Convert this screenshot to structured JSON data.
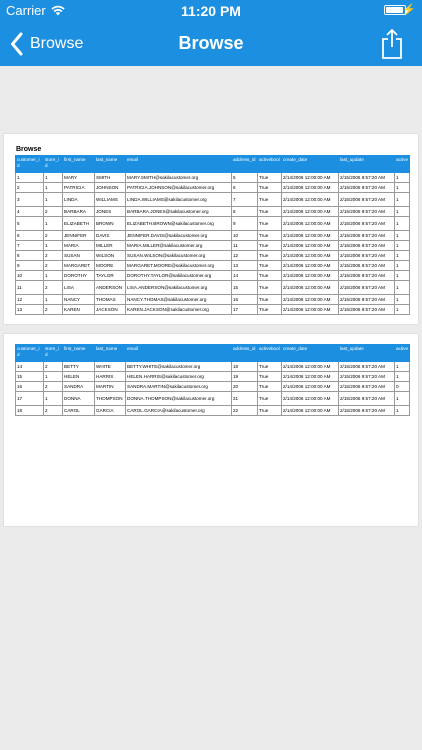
{
  "status": {
    "carrier": "Carrier",
    "time": "11:20 PM",
    "battery_fill": 0.95
  },
  "nav": {
    "back_label": "Browse",
    "title": "Browse"
  },
  "report": {
    "title": "Browse",
    "columns": [
      "customer_id",
      "store_id",
      "first_name",
      "last_name",
      "email",
      "address_id",
      "activebool",
      "create_date",
      "last_update",
      "active"
    ],
    "page1_rows": [
      [
        "1",
        "1",
        "MARY",
        "SMITH",
        "MARY.SMITH@sakilacustomer.org",
        "5",
        "True",
        "2/14/2006 12:00:00 AM",
        "2/15/2006 9:57:20 AM",
        "1"
      ],
      [
        "2",
        "1",
        "PATRICIA",
        "JOHNSON",
        "PATRICIA.JOHNSON@sakilacustomer.org",
        "6",
        "True",
        "2/14/2006 12:00:00 AM",
        "2/15/2006 9:57:20 AM",
        "1"
      ],
      [
        "3",
        "1",
        "LINDA",
        "WILLIAMS",
        "LINDA.WILLIAMS@sakilacustomer.org",
        "7",
        "True",
        "2/14/2006 12:00:00 AM",
        "2/15/2006 9:57:20 AM",
        "1"
      ],
      [
        "4",
        "2",
        "BARBARA",
        "JONES",
        "BARBARA.JONES@sakilacustomer.org",
        "8",
        "True",
        "2/14/2006 12:00:00 AM",
        "2/15/2006 9:57:20 AM",
        "1"
      ],
      [
        "5",
        "1",
        "ELIZABETH",
        "BROWN",
        "ELIZABETH.BROWN@sakilacustomer.org",
        "9",
        "True",
        "2/14/2006 12:00:00 AM",
        "2/15/2006 9:57:20 AM",
        "1"
      ],
      [
        "6",
        "2",
        "JENNIFER",
        "DAVIS",
        "JENNIFER.DAVIS@sakilacustomer.org",
        "10",
        "True",
        "2/14/2006 12:00:00 AM",
        "2/15/2006 9:57:20 AM",
        "1"
      ],
      [
        "7",
        "1",
        "MARIA",
        "MILLER",
        "MARIA.MILLER@sakilacustomer.org",
        "11",
        "True",
        "2/14/2006 12:00:00 AM",
        "2/15/2006 9:57:20 AM",
        "1"
      ],
      [
        "8",
        "2",
        "SUSAN",
        "WILSON",
        "SUSAN.WILSON@sakilacustomer.org",
        "12",
        "True",
        "2/14/2006 12:00:00 AM",
        "2/15/2006 9:57:20 AM",
        "1"
      ],
      [
        "9",
        "2",
        "MARGARET",
        "MOORE",
        "MARGARET.MOORE@sakilacustomer.org",
        "13",
        "True",
        "2/14/2006 12:00:00 AM",
        "2/15/2006 9:57:20 AM",
        "1"
      ],
      [
        "10",
        "1",
        "DOROTHY",
        "TAYLOR",
        "DOROTHY.TAYLOR@sakilacustomer.org",
        "14",
        "True",
        "2/14/2006 12:00:00 AM",
        "2/15/2006 9:57:20 AM",
        "1"
      ],
      [
        "11",
        "2",
        "LISA",
        "ANDERSON",
        "LISA.ANDERSON@sakilacustomer.org",
        "15",
        "True",
        "2/14/2006 12:00:00 AM",
        "2/15/2006 9:57:20 AM",
        "1"
      ],
      [
        "12",
        "1",
        "NANCY",
        "THOMAS",
        "NANCY.THOMAS@sakilacustomer.org",
        "16",
        "True",
        "2/14/2006 12:00:00 AM",
        "2/15/2006 9:57:20 AM",
        "1"
      ],
      [
        "13",
        "2",
        "KAREN",
        "JACKSON",
        "KAREN.JACKSON@sakilacustomer.org",
        "17",
        "True",
        "2/14/2006 12:00:00 AM",
        "2/15/2006 9:57:20 AM",
        "1"
      ]
    ],
    "page2_rows": [
      [
        "14",
        "2",
        "BETTY",
        "WHITE",
        "BETTY.WHITE@sakilacustomer.org",
        "18",
        "True",
        "2/14/2006 12:00:00 AM",
        "2/15/2006 9:57:20 AM",
        "1"
      ],
      [
        "15",
        "1",
        "HELEN",
        "HARRIS",
        "HELEN.HARRIS@sakilacustomer.org",
        "19",
        "True",
        "2/14/2006 12:00:00 AM",
        "2/15/2006 9:57:20 AM",
        "1"
      ],
      [
        "16",
        "2",
        "SANDRA",
        "MARTIN",
        "SANDRA.MARTIN@sakilacustomer.org",
        "20",
        "True",
        "2/14/2006 12:00:00 AM",
        "2/15/2006 9:57:20 AM",
        "0"
      ],
      [
        "17",
        "1",
        "DONNA",
        "THOMPSON",
        "DONNA.THOMPSON@sakilacustomer.org",
        "21",
        "True",
        "2/14/2006 12:00:00 AM",
        "2/15/2006 9:57:20 AM",
        "1"
      ],
      [
        "18",
        "2",
        "CAROL",
        "GARCIA",
        "CAROL.GARCIA@sakilacustomer.org",
        "22",
        "True",
        "2/14/2006 12:00:00 AM",
        "2/15/2006 9:57:20 AM",
        "1"
      ]
    ]
  }
}
